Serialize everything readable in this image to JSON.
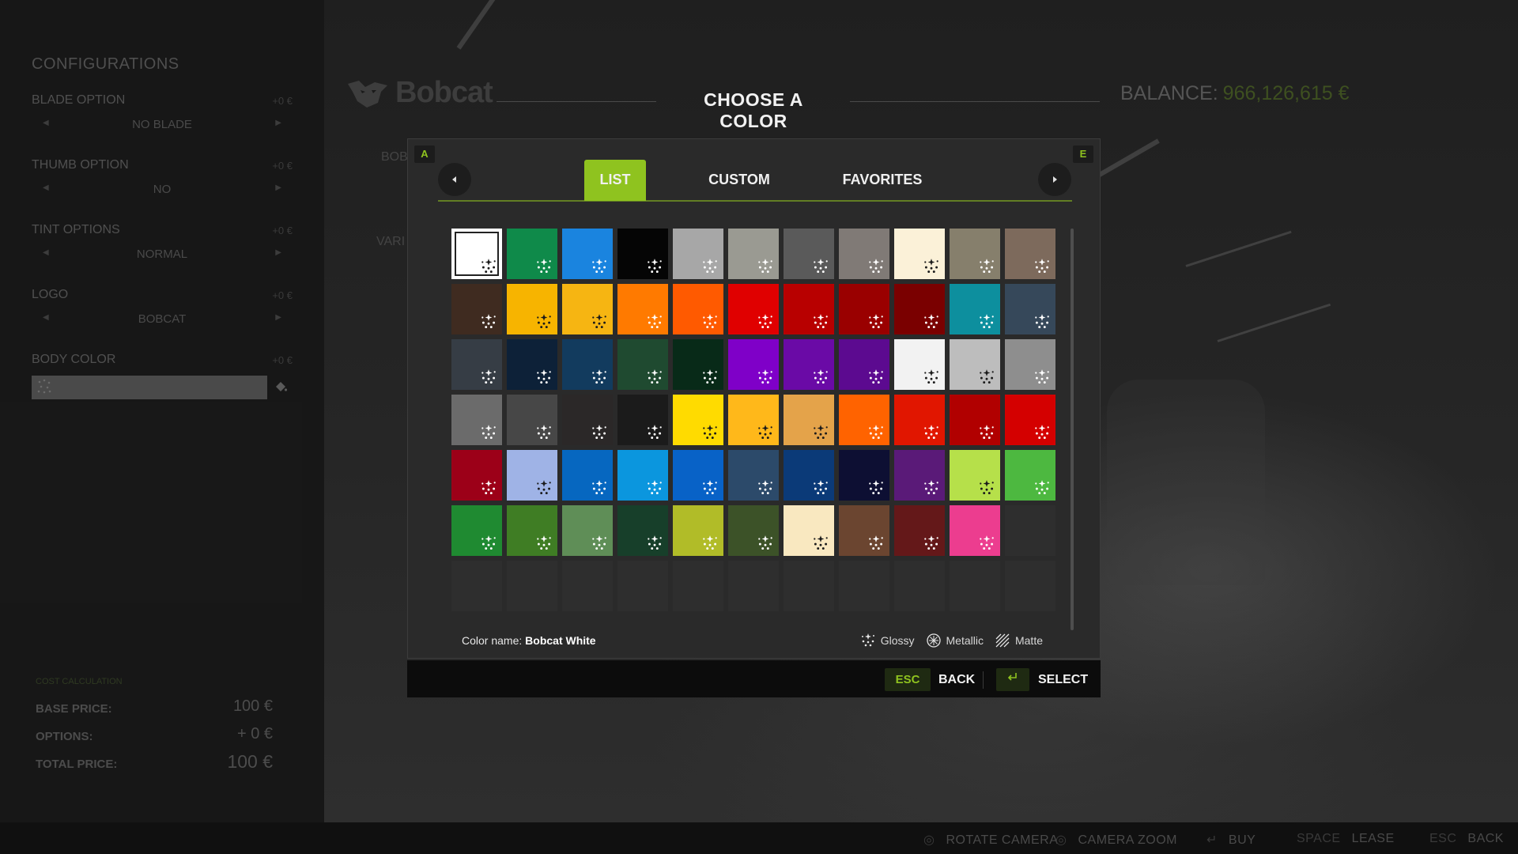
{
  "left_panel": {
    "title": "CONFIGURATIONS",
    "configs": [
      {
        "name": "BLADE OPTION",
        "price": "+0 €",
        "value": "NO BLADE"
      },
      {
        "name": "THUMB OPTION",
        "price": "+0 €",
        "value": "NO"
      },
      {
        "name": "TINT OPTIONS",
        "price": "+0 €",
        "value": "NORMAL"
      },
      {
        "name": "LOGO",
        "price": "+0 €",
        "value": "BOBCAT"
      }
    ],
    "body_color": {
      "name": "BODY COLOR",
      "price": "+0 €"
    },
    "cost": {
      "header": "COST CALCULATION",
      "base_label": "BASE PRICE:",
      "base_value": "100 €",
      "options_label": "OPTIONS:",
      "options_value": "+ 0 €",
      "total_label": "TOTAL PRICE:",
      "total_value": "100 €"
    }
  },
  "header": {
    "brand": "Bobcat",
    "dialog_title": "CHOOSE A COLOR",
    "balance_label": "BALANCE:",
    "balance_value": "966,126,615 €",
    "ghost_brand": "BOB",
    "ghost_variant": "VARI"
  },
  "dialog": {
    "key_left": "A",
    "key_right": "E",
    "tabs": [
      {
        "label": "LIST",
        "active": true
      },
      {
        "label": "CUSTOM",
        "active": false
      },
      {
        "label": "FAVORITES",
        "active": false
      }
    ],
    "swatches": [
      "#ffffff",
      "#0f8a4a",
      "#1a84df",
      "#050505",
      "#a7a7a7",
      "#9a9a92",
      "#5a5a5a",
      "#807a76",
      "#fbf1d8",
      "#867f6c",
      "#7d6a5c",
      "#3f2b20",
      "#f7b400",
      "#f6b512",
      "#ff7a00",
      "#ff5a00",
      "#e00000",
      "#b80000",
      "#9a0000",
      "#7a0000",
      "#0d8f9e",
      "#36485a",
      "#363d45",
      "#0d2138",
      "#123b5e",
      "#1f4a30",
      "#082a18",
      "#7f00c8",
      "#6a0aa6",
      "#5c0a90",
      "#f2f2f2",
      "#bdbdbd",
      "#8e8e8e",
      "#6b6b6b",
      "#474747",
      "#2b2828",
      "#1b1b1b",
      "#ffdb00",
      "#ffb81a",
      "#e4a34a",
      "#ff6300",
      "#e11600",
      "#b10000",
      "#d40000",
      "#9c0018",
      "#9fb3e6",
      "#0667c0",
      "#0b96de",
      "#0862c7",
      "#2c4a6a",
      "#0b3a78",
      "#0d0f33",
      "#5a1a78",
      "#b6e04a",
      "#4db840",
      "#1f8a31",
      "#3f7d24",
      "#5f8e57",
      "#173f2a",
      "#b1bc28",
      "#3c5228",
      "#f9e8c0",
      "#6b4530",
      "#641819",
      "#ec3d8f"
    ],
    "selected_index": 0,
    "color_name_label": "Color name:",
    "color_name_value": "Bobcat White",
    "legend": {
      "glossy": "Glossy",
      "metallic": "Metallic",
      "matte": "Matte"
    }
  },
  "footer": {
    "back_key": "ESC",
    "back_label": "BACK",
    "select_label": "SELECT"
  },
  "bottom_hints": [
    {
      "key": "",
      "label": "ROTATE CAMERA"
    },
    {
      "key": "",
      "label": "CAMERA ZOOM"
    },
    {
      "key": "",
      "label": "BUY"
    },
    {
      "key": "SPACE",
      "label": "LEASE"
    },
    {
      "key": "ESC",
      "label": "BACK"
    }
  ],
  "colors": {
    "accent": "#8fc31f",
    "panel": "#2a2a2a",
    "background": "#161616"
  }
}
